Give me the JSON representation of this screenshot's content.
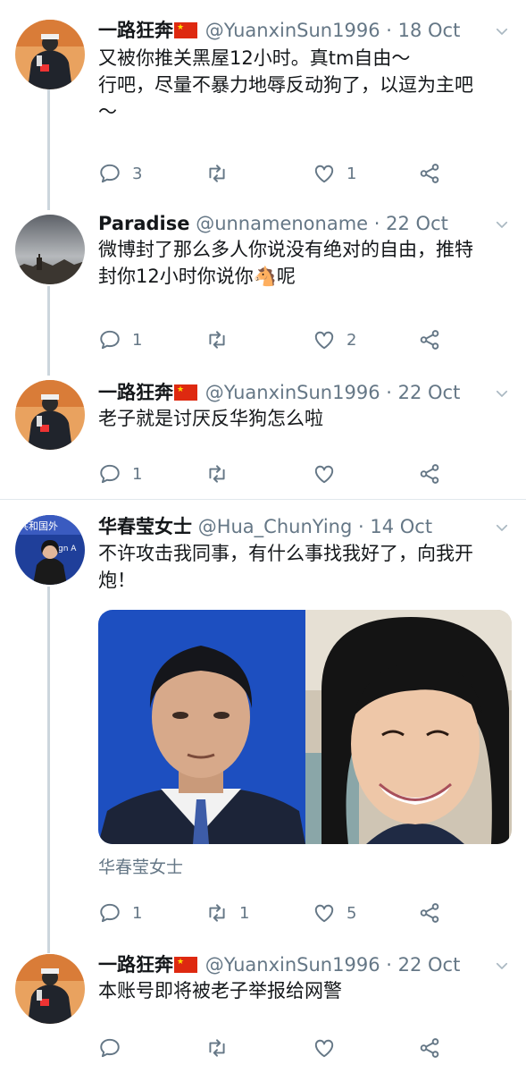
{
  "tweets": [
    {
      "name": "一路狂奔",
      "has_flag": true,
      "handle": "@YuanxinSun1996",
      "date": "18 Oct",
      "text_lines": [
        "又被你推关黑屋12小时。真tm自由～",
        "行吧，尽量不暴力地辱反动狗了，以逗为主吧",
        "～"
      ],
      "replies": "3",
      "retweets": "",
      "likes": "1"
    },
    {
      "name": "Paradise",
      "has_flag": false,
      "handle": "@unnamenoname",
      "date": "22 Oct",
      "text_lines": [
        "微博封了那么多人你说没有绝对的自由，推特",
        "封你12小时你说你🐴呢"
      ],
      "replies": "1",
      "retweets": "",
      "likes": "2"
    },
    {
      "name": "一路狂奔",
      "has_flag": true,
      "handle": "@YuanxinSun1996",
      "date": "22 Oct",
      "text_lines": [
        "老子就是讨厌反华狗怎么啦"
      ],
      "replies": "1",
      "retweets": "",
      "likes": ""
    },
    {
      "name": "华春莹女士",
      "has_flag": false,
      "handle": "@Hua_ChunYing",
      "date": "14 Oct",
      "text_lines": [
        "不许攻击我同事，有什么事找我好了，向我开",
        "炮！"
      ],
      "media_source": "华春莹女士",
      "replies": "1",
      "retweets": "1",
      "likes": "5"
    },
    {
      "name": "一路狂奔",
      "has_flag": true,
      "handle": "@YuanxinSun1996",
      "date": "22 Oct",
      "text_lines": [
        "本账号即将被老子举报给网警"
      ],
      "replies": "",
      "retweets": "",
      "likes": ""
    }
  ],
  "separator": "·",
  "colors": {
    "text": "#14171a",
    "secondary": "#657786",
    "thread_line": "#ccd6dd",
    "flag_red": "#de2910",
    "flag_yellow": "#ffde00"
  }
}
